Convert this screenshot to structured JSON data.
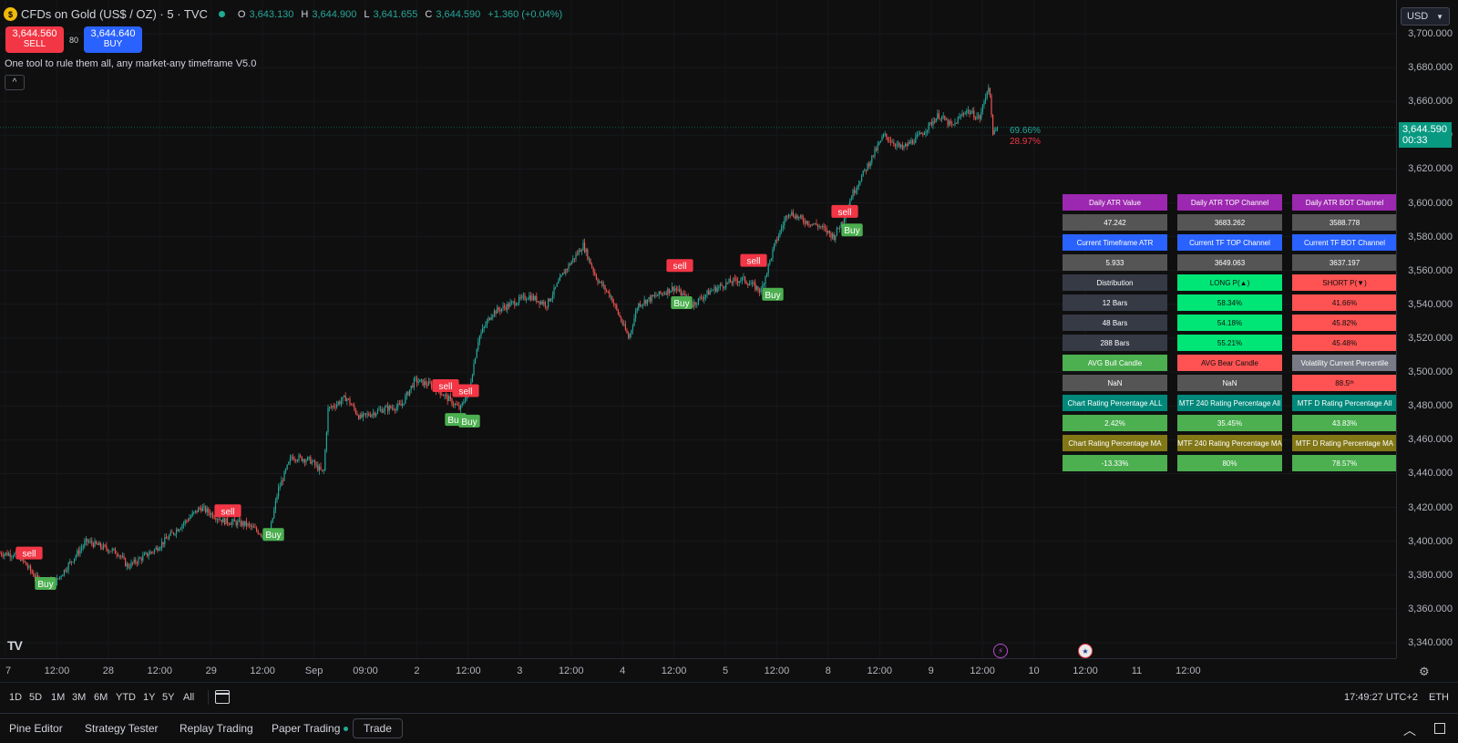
{
  "header": {
    "symbol_icon": "gold-coin-icon",
    "title": "CFDs on Gold (US$ / OZ) · 5 · TVC",
    "ohlc": [
      {
        "key": "O",
        "value": "3,643.130"
      },
      {
        "key": "H",
        "value": "3,644.900"
      },
      {
        "key": "L",
        "value": "3,641.655"
      },
      {
        "key": "C",
        "value": "3,644.590"
      }
    ],
    "change": "+1.360 (+0.04%)"
  },
  "trade": {
    "sell_price": "3,644.560",
    "sell_label": "SELL",
    "spread": "80",
    "buy_price": "3,644.640",
    "buy_label": "BUY"
  },
  "indicator": {
    "name": "One tool to rule them all, any market-any timeframe V5.0",
    "collapse_icon": "chevron-up-icon"
  },
  "price_axis": {
    "currency": "USD",
    "labels": [
      "3,700.000",
      "3,680.000",
      "3,660.000",
      "3,640.000",
      "3,620.000",
      "3,600.000",
      "3,580.000",
      "3,560.000",
      "3,540.000",
      "3,520.000",
      "3,500.000",
      "3,480.000",
      "3,460.000",
      "3,440.000",
      "3,420.000",
      "3,400.000",
      "3,380.000",
      "3,360.000",
      "3,340.000"
    ],
    "current_price": "3,644.590",
    "countdown": "00:33"
  },
  "time_axis": {
    "labels": [
      "7",
      "12:00",
      "28",
      "12:00",
      "29",
      "12:00",
      "Sep",
      "09:00",
      "2",
      "12:00",
      "3",
      "12:00",
      "4",
      "12:00",
      "5",
      "12:00",
      "8",
      "12:00",
      "9",
      "12:00",
      "10",
      "12:00",
      "11",
      "12:00"
    ]
  },
  "chart_labels": {
    "pct_up": "69.66%",
    "pct_down": "28.97%",
    "sell": "sell",
    "buy": "Buy"
  },
  "signals": [
    {
      "type": "sell",
      "value": 3393
    },
    {
      "type": "buy",
      "value": 3375
    },
    {
      "type": "sell",
      "value": 3418
    },
    {
      "type": "buy",
      "value": 3404
    },
    {
      "type": "sell",
      "value": 3492
    },
    {
      "type": "sell",
      "value": 3489
    },
    {
      "type": "buy",
      "value": 3472
    },
    {
      "type": "buy",
      "value": 3471
    },
    {
      "type": "sell",
      "value": 3563
    },
    {
      "type": "buy",
      "value": 3541
    },
    {
      "type": "sell",
      "value": 3566
    },
    {
      "type": "buy",
      "value": 3546
    },
    {
      "type": "sell",
      "value": 3595
    },
    {
      "type": "buy",
      "value": 3584
    }
  ],
  "table": {
    "rows": [
      [
        {
          "t": "Daily ATR Value",
          "c": "#9c27b0"
        },
        {
          "t": "Daily ATR TOP Channel",
          "c": "#9c27b0"
        },
        {
          "t": "Daily ATR BOT Channel",
          "c": "#9c27b0"
        }
      ],
      [
        {
          "t": "47.242",
          "c": "#555555"
        },
        {
          "t": "3683.262",
          "c": "#555555"
        },
        {
          "t": "3588.778",
          "c": "#555555"
        }
      ],
      [
        {
          "t": "Current Timeframe ATR",
          "c": "#2962ff"
        },
        {
          "t": "Current TF TOP Channel",
          "c": "#2962ff"
        },
        {
          "t": "Current TF BOT Channel",
          "c": "#2962ff"
        }
      ],
      [
        {
          "t": "5.933",
          "c": "#555555"
        },
        {
          "t": "3649.063",
          "c": "#555555"
        },
        {
          "t": "3637.197",
          "c": "#555555"
        }
      ],
      [
        {
          "t": "Distribution",
          "c": "#363a45"
        },
        {
          "t": "LONG P(▲)",
          "c": "#00e676",
          "fg": "#0f0f0f"
        },
        {
          "t": "SHORT P(▼)",
          "c": "#ff5252",
          "fg": "#0f0f0f"
        }
      ],
      [
        {
          "t": "12 Bars",
          "c": "#363a45"
        },
        {
          "t": "58.34%",
          "c": "#00e676",
          "fg": "#0f0f0f"
        },
        {
          "t": "41.66%",
          "c": "#ff5252",
          "fg": "#0f0f0f"
        }
      ],
      [
        {
          "t": "48 Bars",
          "c": "#363a45"
        },
        {
          "t": "54.18%",
          "c": "#00e676",
          "fg": "#0f0f0f"
        },
        {
          "t": "45.82%",
          "c": "#ff5252",
          "fg": "#0f0f0f"
        }
      ],
      [
        {
          "t": "288 Bars",
          "c": "#363a45"
        },
        {
          "t": "55.21%",
          "c": "#00e676",
          "fg": "#0f0f0f"
        },
        {
          "t": "45.48%",
          "c": "#ff5252",
          "fg": "#0f0f0f"
        }
      ],
      [
        {
          "t": "AVG Bull Candle",
          "c": "#4caf50"
        },
        {
          "t": "AVG Bear Candle",
          "c": "#ff5252",
          "fg": "#0f0f0f"
        },
        {
          "t": "Volatility Current Percentile",
          "c": "#787b86"
        }
      ],
      [
        {
          "t": "NaN",
          "c": "#555555"
        },
        {
          "t": "NaN",
          "c": "#555555"
        },
        {
          "t": "88.5ᵗʰ",
          "c": "#ff5252",
          "fg": "#0f0f0f"
        }
      ],
      [
        {
          "t": "Chart Rating Percentage ALL",
          "c": "#00897b"
        },
        {
          "t": "MTF 240 Rating Percentage All",
          "c": "#00897b"
        },
        {
          "t": "MTF D Rating Percentage All",
          "c": "#00897b"
        }
      ],
      [
        {
          "t": "2.42%",
          "c": "#4caf50"
        },
        {
          "t": "35.45%",
          "c": "#4caf50"
        },
        {
          "t": "43.83%",
          "c": "#4caf50"
        }
      ],
      [
        {
          "t": "Chart Rating Percentage MA",
          "c": "#827717"
        },
        {
          "t": "MTF 240 Rating Percentage MA",
          "c": "#827717"
        },
        {
          "t": "MTF D Rating Percentage MA",
          "c": "#827717"
        }
      ],
      [
        {
          "t": "-13.33%",
          "c": "#4caf50"
        },
        {
          "t": "80%",
          "c": "#4caf50"
        },
        {
          "t": "78.57%",
          "c": "#4caf50"
        }
      ]
    ]
  },
  "range_bar": {
    "buttons": [
      "1D",
      "5D",
      "1M",
      "3M",
      "6M",
      "YTD",
      "1Y",
      "5Y",
      "All"
    ],
    "calendar_icon": "calendar-goto-icon",
    "clock": "17:49:27 UTC+2",
    "session": "ETH"
  },
  "bottom_tabs": {
    "pine_editor": "Pine Editor",
    "strategy_tester": "Strategy Tester",
    "replay_trading": "Replay Trading",
    "paper_trading": "Paper Trading",
    "trade": "Trade"
  },
  "logo": "TV",
  "colors": {
    "up": "#26a69a",
    "down": "#ef5350",
    "sell_signal": "#f23645",
    "buy_signal": "#4caf50",
    "background": "#0f0f0f"
  }
}
